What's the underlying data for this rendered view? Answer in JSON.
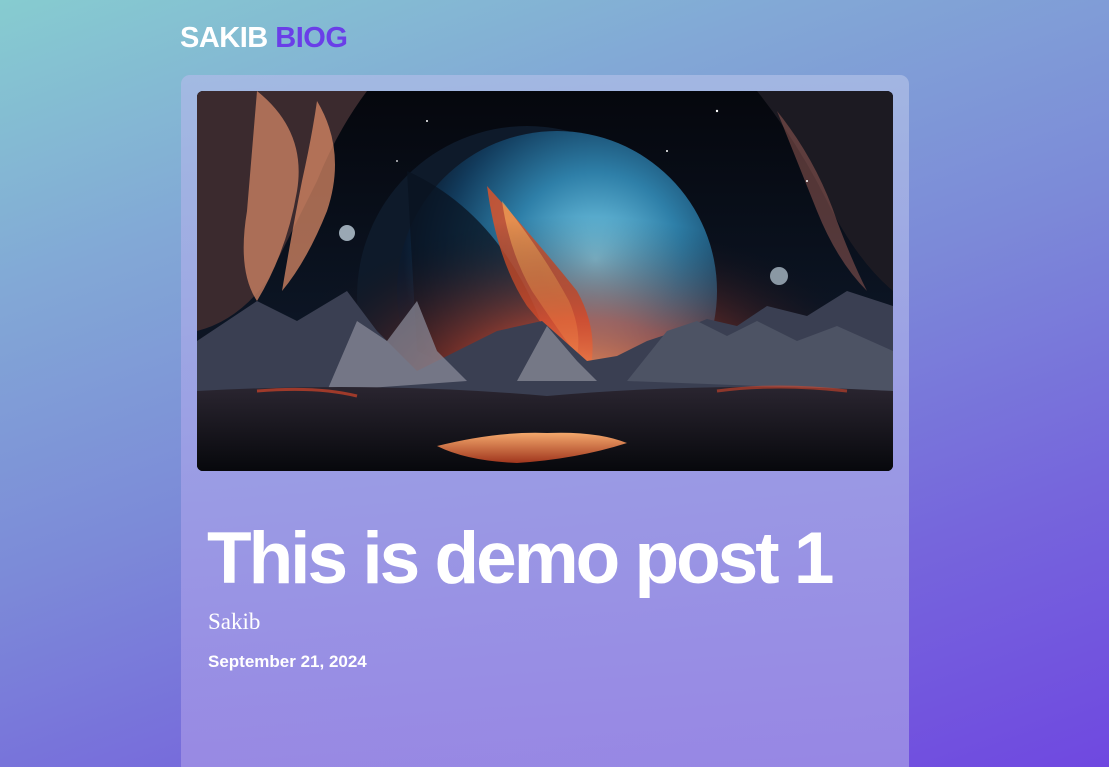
{
  "header": {
    "logo_first": "SAKIB",
    "logo_second": "BIOG"
  },
  "post": {
    "title": "This is demo post 1",
    "author": "Sakib",
    "date": "September 21, 2024"
  },
  "colors": {
    "accent": "#6a3ee8",
    "text": "#ffffff"
  }
}
